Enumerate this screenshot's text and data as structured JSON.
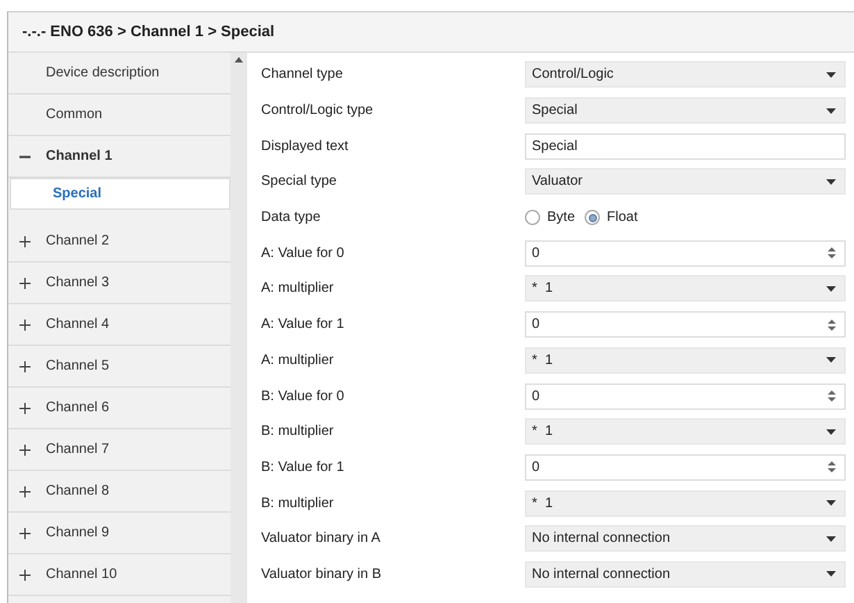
{
  "window": {
    "title": "-.-.- ENO 636 > Channel 1 > Special"
  },
  "sidebar": {
    "items": [
      {
        "label": "Device description",
        "kind": "page",
        "selected": false
      },
      {
        "label": "Common",
        "kind": "page",
        "selected": false
      },
      {
        "label": "Channel 1",
        "kind": "group",
        "expanded": true,
        "selected": false,
        "children": [
          {
            "label": "Special",
            "selected": true
          }
        ]
      },
      {
        "label": "Channel 2",
        "kind": "group",
        "expanded": false,
        "selected": false
      },
      {
        "label": "Channel 3",
        "kind": "group",
        "expanded": false,
        "selected": false
      },
      {
        "label": "Channel 4",
        "kind": "group",
        "expanded": false,
        "selected": false
      },
      {
        "label": "Channel 5",
        "kind": "group",
        "expanded": false,
        "selected": false
      },
      {
        "label": "Channel 6",
        "kind": "group",
        "expanded": false,
        "selected": false
      },
      {
        "label": "Channel 7",
        "kind": "group",
        "expanded": false,
        "selected": false
      },
      {
        "label": "Channel 8",
        "kind": "group",
        "expanded": false,
        "selected": false
      },
      {
        "label": "Channel 9",
        "kind": "group",
        "expanded": false,
        "selected": false
      },
      {
        "label": "Channel 10",
        "kind": "group",
        "expanded": false,
        "selected": false
      }
    ]
  },
  "parameters": [
    {
      "label": "Channel type",
      "kind": "dropdown",
      "value": "Control/Logic"
    },
    {
      "label": "Control/Logic type",
      "kind": "dropdown",
      "value": "Special"
    },
    {
      "label": "Displayed text",
      "kind": "text",
      "value": "Special"
    },
    {
      "label": "Special type",
      "kind": "dropdown",
      "value": "Valuator"
    },
    {
      "label": "Data type",
      "kind": "radio",
      "options": [
        {
          "label": "Byte",
          "selected": false
        },
        {
          "label": "Float",
          "selected": true
        }
      ]
    },
    {
      "label": "A: Value for 0",
      "kind": "spin",
      "value": "0"
    },
    {
      "label": "A: multiplier",
      "kind": "dropdown",
      "value": "*  1"
    },
    {
      "label": "A: Value for 1",
      "kind": "spin",
      "value": "0"
    },
    {
      "label": "A: multiplier",
      "kind": "dropdown",
      "value": "*  1"
    },
    {
      "label": "B: Value for 0",
      "kind": "spin",
      "value": "0"
    },
    {
      "label": "B: multiplier",
      "kind": "dropdown",
      "value": "*  1"
    },
    {
      "label": "B: Value for 1",
      "kind": "spin",
      "value": "0"
    },
    {
      "label": "B: multiplier",
      "kind": "dropdown",
      "value": "*  1"
    },
    {
      "label": "Valuator binary in A",
      "kind": "dropdown",
      "value": "No internal connection"
    },
    {
      "label": "Valuator binary in B",
      "kind": "dropdown",
      "value": "No internal connection"
    }
  ]
}
